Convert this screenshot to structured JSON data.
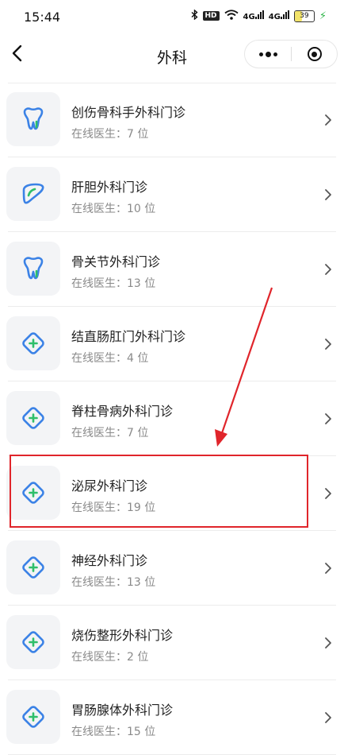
{
  "status_bar": {
    "time": "15:44",
    "hd_label": "HD",
    "signal_1": "4G",
    "signal_2": "4G",
    "battery_level": 39,
    "battery_label": "39"
  },
  "nav": {
    "title": "外科"
  },
  "departments": [
    {
      "name": "创伤骨科手外科门诊",
      "online": "在线医生：7 位",
      "icon": "tooth-icon"
    },
    {
      "name": "肝胆外科门诊",
      "online": "在线医生：10 位",
      "icon": "liver-icon"
    },
    {
      "name": "骨关节外科门诊",
      "online": "在线医生：13 位",
      "icon": "tooth-icon"
    },
    {
      "name": "结直肠肛门外科门诊",
      "online": "在线医生：4 位",
      "icon": "medical-cross-icon"
    },
    {
      "name": "脊柱骨病外科门诊",
      "online": "在线医生：7 位",
      "icon": "medical-cross-icon"
    },
    {
      "name": "泌尿外科门诊",
      "online": "在线医生：19 位",
      "icon": "medical-cross-icon"
    },
    {
      "name": "神经外科门诊",
      "online": "在线医生：13 位",
      "icon": "medical-cross-icon"
    },
    {
      "name": "烧伤整形外科门诊",
      "online": "在线医生：2 位",
      "icon": "medical-cross-icon"
    },
    {
      "name": "胃肠腺体外科门诊",
      "online": "在线医生：15 位",
      "icon": "medical-cross-icon"
    }
  ],
  "colors": {
    "icon_blue": "#3b82e6",
    "icon_green": "#2fbf6a",
    "highlight_red": "#e0252b"
  }
}
